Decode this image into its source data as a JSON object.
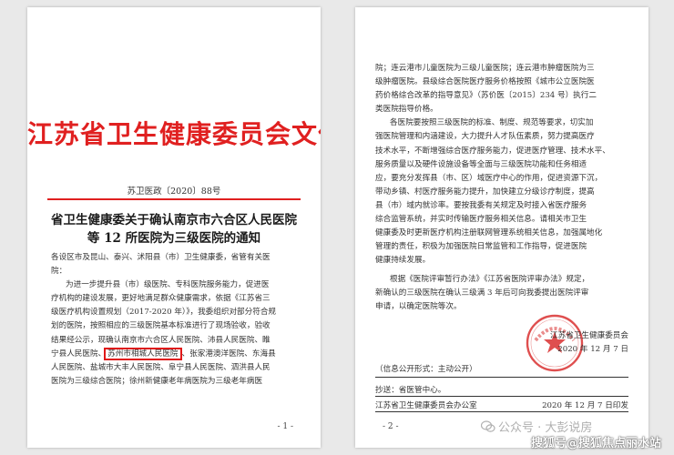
{
  "page1": {
    "header": "江苏省卫生健康委员会文件",
    "doc_number": "苏卫医政〔2020〕88号",
    "title_lines": [
      "省卫生健康委关于确认南京市六合区人民医院",
      "等 12 所医院为三级医院的通知"
    ],
    "addressee_lines": [
      "各设区市及昆山、泰兴、沭阳县（市）卫生健康委，省管有关医",
      "院："
    ],
    "body_lines_before": [
      "为进一步提升县（市）级医院、专科医院服务能力，促进医",
      "疗机构的建设发展，更好地满足群众健康需求，依据《江苏省三",
      "级医疗机构设置规划（2017-2020 年）》，我委组织对部分符合规",
      "划的医院，按照相应的三级医院基本标准进行了现场验收，验收",
      "结果经公示，现确认南京市六合区人民医院、沛县人民医院、睢",
      "宁县人民医院、"
    ],
    "highlighted": "苏州市相城人民医院",
    "after_highlight": "、张家港澳洋医院、东海县",
    "body_lines_after": [
      "人民医院、盐城市大丰人民医院、阜宁县人民医院、泗洪县人民",
      "医院为三级综合医院；徐州新健康老年病医院为三级老年病医"
    ],
    "page_number": "- 1 -"
  },
  "page2": {
    "body_a": [
      "院；连云港市儿童医院为三级儿童医院；连云港市肿瘤医院为三",
      "级肿瘤医院。县级综合医院医疗服务价格按照《城市公立医院医",
      "药价格综合改革的指导意见》（苏价医〔2015〕234 号）执行二",
      "类医院指导价格。"
    ],
    "body_a_indent": [
      "各医院要按照三级医院的标准、制度、规范等要求，切实加",
      "强医院管理和内涵建设，大力提升人才队伍素质，努力提高医疗",
      "技术水平，不断增强综合医疗服务能力，促进医疗管理、技术水平、",
      "服务质量以及硬件设施设备等全面与三级医院功能和任务相适",
      "应，要充分发挥县（市、区）域医疗中心的作用，促进资源下沉，",
      "带动乡镇、村医疗服务能力提升，加快建立分级诊疗制度，提高",
      "县（市）域内就诊率。要按我委有关规定及时接入省医疗服务",
      "综合监管系统，并实时传输医疗服务相关信息。请相关市卫生",
      "健康委及时更新医疗机构注册联网管理系统相关信息，加强属地化",
      "管理的责任，积极为加强医院日常监管和工作指导，促进医院",
      "健康持续发展。"
    ],
    "body_b": [
      "根据《医院评审暂行办法》《江苏省医院评审办法》规定，",
      "新确认的三级医院在确认三级满 3 年后可向我委提出医院评审",
      "申请，以确定医院等次。"
    ],
    "signer": "江苏省卫生健康委员会",
    "sign_date": "2020 年 12 月 7 日",
    "info_public": "（信息公开形式：主动公开）",
    "cc": "抄送：省医管中心。",
    "issuer": "江苏省卫生健康委员会办公室",
    "issue_date": "2020 年 12 月 7 日印发",
    "page_number": "- 2 -"
  },
  "watermark": {
    "top": "公众号 · 大彭说房",
    "bottom": "搜狐号@搜狐焦点丽水站"
  },
  "colors": {
    "header_red": "#e02020",
    "highlight_box": "#e01818",
    "seal_red": "#d93030"
  }
}
